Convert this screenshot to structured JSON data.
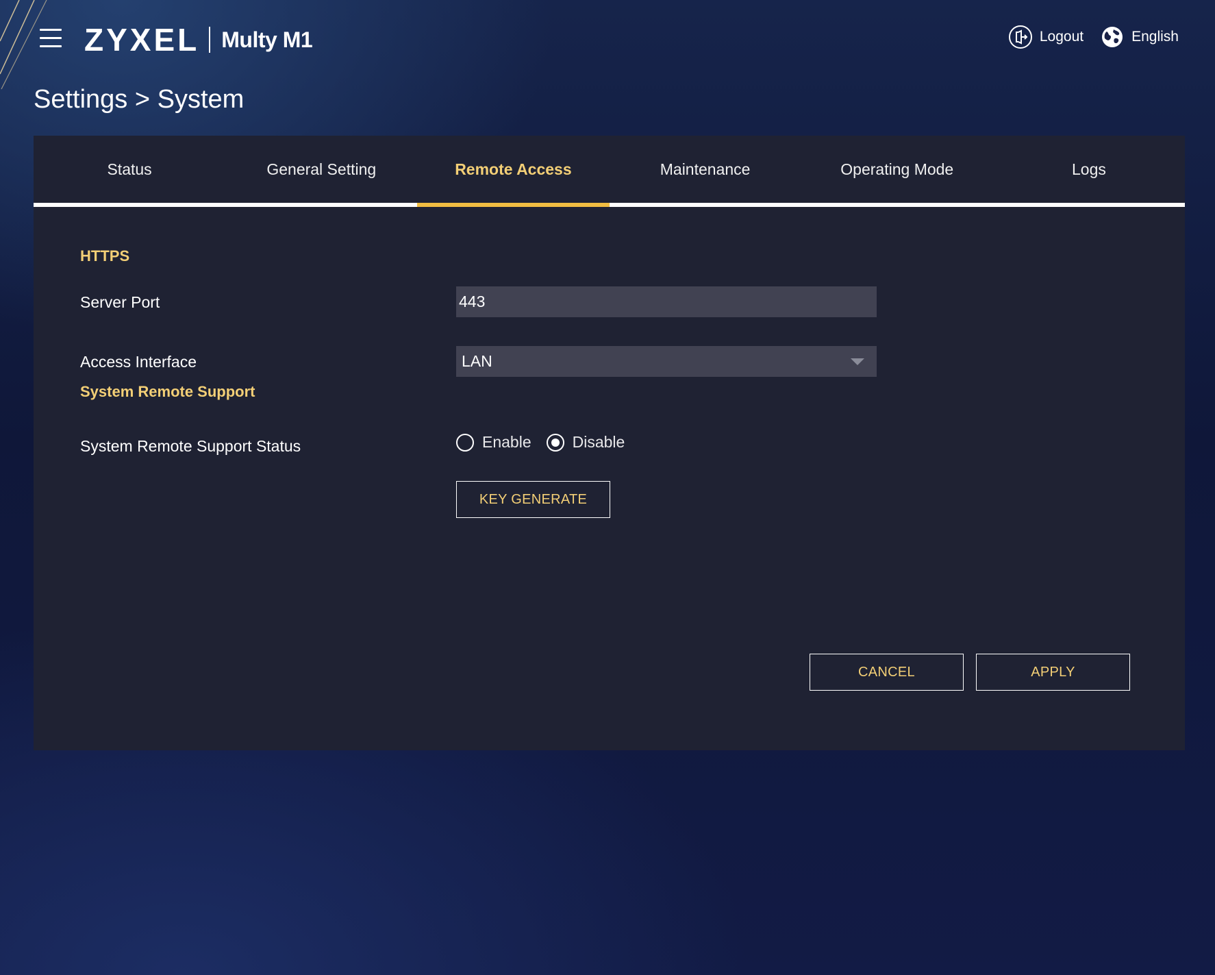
{
  "header": {
    "brand": "ZYXEL",
    "model": "Multy M1",
    "logout_label": "Logout",
    "language_label": "English"
  },
  "page": {
    "title": "Settings > System"
  },
  "tabs": [
    {
      "label": "Status",
      "active": false
    },
    {
      "label": "General Setting",
      "active": false
    },
    {
      "label": "Remote Access",
      "active": true
    },
    {
      "label": "Maintenance",
      "active": false
    },
    {
      "label": "Operating Mode",
      "active": false
    },
    {
      "label": "Logs",
      "active": false
    }
  ],
  "https": {
    "section_title": "HTTPS",
    "server_port_label": "Server Port",
    "server_port_value": "443",
    "access_interface_label": "Access Interface",
    "access_interface_value": "LAN"
  },
  "remote_support": {
    "section_title": "System Remote Support",
    "status_label": "System Remote Support Status",
    "enable_label": "Enable",
    "disable_label": "Disable",
    "selected": "Disable",
    "key_generate_label": "KEY GENERATE"
  },
  "footer": {
    "cancel_label": "CANCEL",
    "apply_label": "APPLY"
  },
  "colors": {
    "accent": "#f3cf76",
    "active_tab_underline": "#f1bd42",
    "panel_bg": "#1f2233",
    "input_bg": "#414252"
  }
}
